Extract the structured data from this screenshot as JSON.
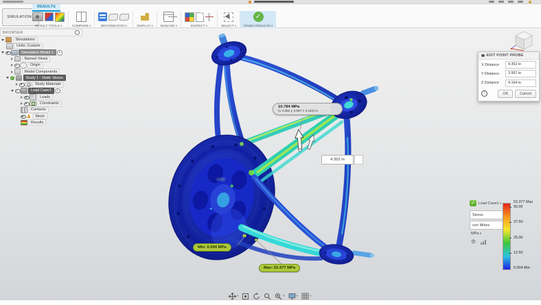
{
  "toolbar": {
    "context_button": "SIMULATION",
    "active_tab": "RESULTS",
    "groups": [
      "RESULT TOOLS",
      "COMPARE",
      "DEFORMATION",
      "DISPLAY",
      "MANAGE",
      "INSPECT",
      "SELECT",
      "FINISH RESULTS"
    ]
  },
  "browser": {
    "title": "BROWSER",
    "items": [
      {
        "label": "Simulations"
      },
      {
        "label": "Units: Custom"
      },
      {
        "label": "Simulation Model 1"
      },
      {
        "label": "Named Views"
      },
      {
        "label": "Origin"
      },
      {
        "label": "Model Components"
      },
      {
        "label": "Study 1 - Static Stress"
      },
      {
        "label": "Study Materials"
      },
      {
        "label": "Load Case1"
      },
      {
        "label": "Loads"
      },
      {
        "label": "Constraints"
      },
      {
        "label": "Contacts"
      },
      {
        "label": "Mesh"
      },
      {
        "label": "Results"
      }
    ]
  },
  "probe_dialog": {
    "title": "EDIT POINT PROBE",
    "fields": [
      {
        "label": "X Distance",
        "value": "4.352 in"
      },
      {
        "label": "Y Distance",
        "value": "3.957 in"
      },
      {
        "label": "Z Distance",
        "value": "4.164 in"
      }
    ],
    "ok_label": "OK",
    "cancel_label": "Cancel"
  },
  "viewport": {
    "probe_tooltip_line1": "10.784 MPa",
    "probe_tooltip_line2": "(x 4.352 y 3.957 z 4.164) in",
    "dimension_value": "4.352 in",
    "min_callout": "Min: 0.004 MPa",
    "max_callout": "Max: 53.377 MPa",
    "surface_probe_value": "2.452"
  },
  "legend": {
    "load_case_label": "Load Case1",
    "result_dropdown": "Stress",
    "component_dropdown": "von Mises",
    "unit_label": "MPa",
    "max_label": "53.377 Max",
    "tick_50": "50.00",
    "tick_37": "37.50",
    "tick_25": "25.00",
    "tick_12": "12.50",
    "min_label": "0.004 Min",
    "gradient_colors": [
      "#e8231b",
      "#f5971f",
      "#f5e62e",
      "#3cc63c",
      "#2cc4e0",
      "#1b24e4"
    ]
  },
  "icons": {
    "nav_bar": [
      "pan",
      "fit",
      "orbit",
      "look-at",
      "zoom",
      "display-settings",
      "grid-snaps"
    ],
    "legend": [
      "check",
      "gear",
      "histogram"
    ],
    "status_colors": {
      "accent_blue": "#0696d7",
      "callout_green": "#aec93c",
      "finish_green": "#64b445"
    }
  }
}
